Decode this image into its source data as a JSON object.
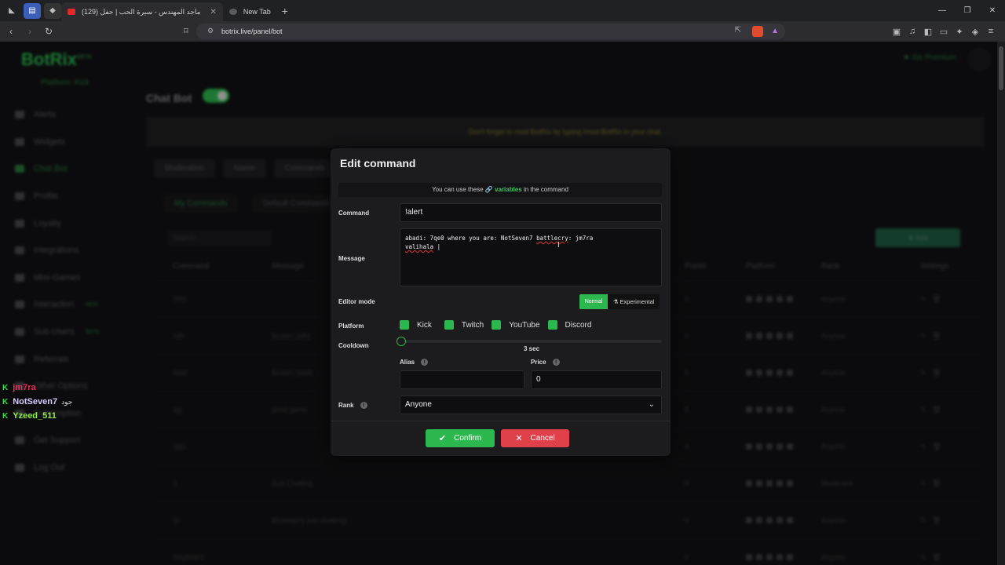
{
  "browser": {
    "tabs": [
      {
        "title": "(129) ماجد المهندس - سيرة الحب | حفل",
        "active": true,
        "favicon_color": "#e02a2a"
      },
      {
        "title": "New Tab",
        "active": false,
        "favicon_color": "#5a5a60"
      }
    ],
    "url": "botrix.live/panel/bot"
  },
  "app": {
    "logo": "BotRix",
    "logo_badge": "BETA",
    "platform": "Platform: Kick",
    "go_premium": "Go Premium",
    "sidebar": [
      {
        "label": "Alerts"
      },
      {
        "label": "Widgets"
      },
      {
        "label": "Chat Bot",
        "active": true
      },
      {
        "label": "Profile"
      },
      {
        "label": "Loyalty"
      },
      {
        "label": "Integrations"
      },
      {
        "label": "Mini-Games"
      },
      {
        "label": "Interaction",
        "badge": "NEW"
      },
      {
        "label": "Sub-Users",
        "badge": "BETA"
      },
      {
        "label": "Referrals"
      },
      {
        "label": "Other Options"
      },
      {
        "label": "Subscription"
      },
      {
        "label": "Get Support"
      },
      {
        "label": "Log Out"
      }
    ],
    "page_title": "Chat Bot",
    "notice": "Don't forget to mod BotRix by typing /mod BotRix in your chat.",
    "tabs": [
      "Moderation",
      "Name",
      "Commands"
    ],
    "subtabs": [
      "My Commands",
      "Default Commands"
    ],
    "search_placeholder": "Search...",
    "add_label": "Add",
    "table": {
      "headers": [
        "Command",
        "Message",
        "Points",
        "Platform",
        "Rank",
        "Settings"
      ],
      "rows": [
        {
          "command": "!555",
          "message": "",
          "points": "0",
          "rank": "Anyone"
        },
        {
          "command": "!afk",
          "message": "$(user) {afk}",
          "points": "0",
          "rank": "Anyone"
        },
        {
          "command": "!add",
          "message": "$(user) {add}",
          "points": "0",
          "rank": "Anyone"
        },
        {
          "command": "!gg",
          "message": "good game",
          "points": "0",
          "rank": "Anyone"
        },
        {
          "command": "!ggs",
          "message": "",
          "points": "0",
          "rank": "Anyone"
        },
        {
          "command": "!j",
          "message": "Just Chatting",
          "points": "0",
          "rank": "Moderator"
        },
        {
          "command": "!jc",
          "message": "$(category just chatting)",
          "points": "0",
          "rank": "Anyone"
        },
        {
          "command": "!keyboard",
          "message": "",
          "points": "0",
          "rank": "Anyone"
        }
      ]
    }
  },
  "chat_overlay": [
    {
      "platform": "K",
      "name": "jm7ra",
      "extra": ""
    },
    {
      "platform": "K",
      "name": "NotSeven7",
      "extra": "جود"
    },
    {
      "platform": "K",
      "name": "Yzeed_511",
      "extra": ""
    }
  ],
  "modal": {
    "title": "Edit command",
    "variables_pre": "You can use these",
    "variables_link": "variables",
    "variables_post": "in the command",
    "command_label": "Command",
    "command_value": "!alert",
    "message_label": "Message",
    "message_line1_a": "abadi: 7qe0 where you are: NotSeven7 ",
    "message_line1_b": "battlecry",
    "message_line1_c": ": jm7ra",
    "message_line2": "valihala",
    "editor_mode_label": "Editor mode",
    "mode_normal": "Normal",
    "mode_experimental": "Experimental",
    "platform_label": "Platform",
    "platforms": [
      "Kick",
      "Twitch",
      "YouTube",
      "Discord"
    ],
    "cooldown_label": "Cooldown",
    "cooldown_value": "3 sec",
    "cooldown_fraction": 0,
    "alias_label": "Alias",
    "alias_value": "",
    "price_label": "Price",
    "price_value": "0",
    "rank_label": "Rank",
    "rank_value": "Anyone",
    "confirm_label": "Confirm",
    "cancel_label": "Cancel"
  },
  "colors": {
    "accent": "#2cb84f",
    "danger": "#e0404a",
    "modal_bg": "#1c1c1f"
  }
}
